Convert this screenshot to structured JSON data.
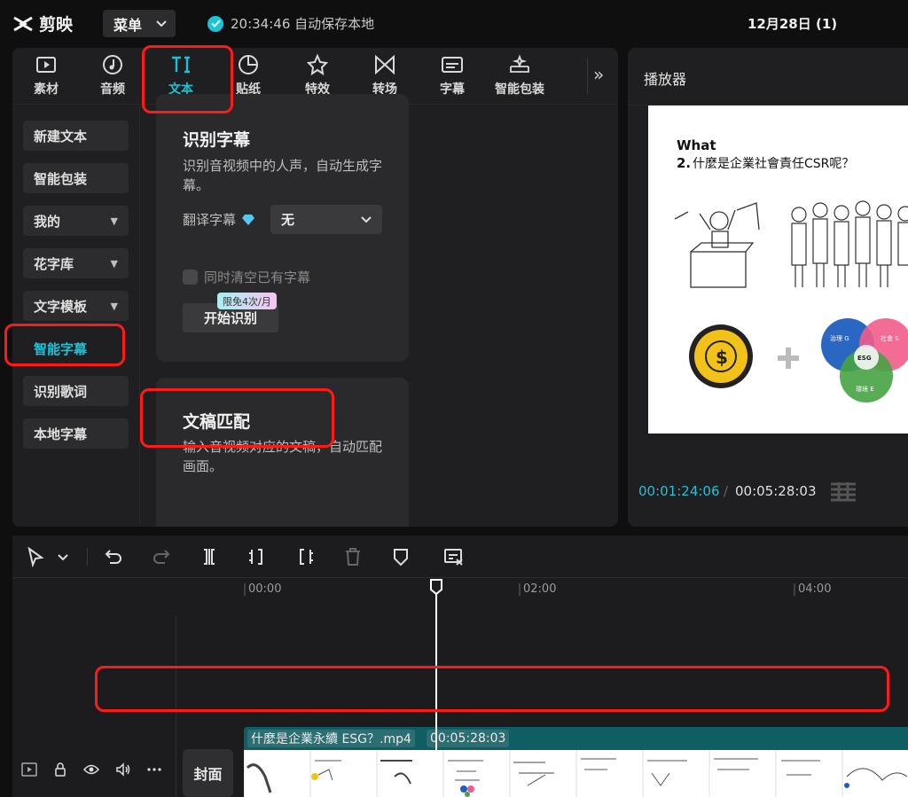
{
  "app": {
    "name": "剪映",
    "menu_label": "菜单",
    "autosave_text": "20:34:46 自动保存本地",
    "project_title": "12月28日 (1)"
  },
  "toolbar": {
    "tabs": [
      {
        "label": "素材",
        "icon": "media-icon"
      },
      {
        "label": "音频",
        "icon": "audio-icon"
      },
      {
        "label": "文本",
        "icon": "text-icon",
        "active": true
      },
      {
        "label": "贴纸",
        "icon": "sticker-icon"
      },
      {
        "label": "特效",
        "icon": "effects-icon"
      },
      {
        "label": "转场",
        "icon": "transition-icon"
      },
      {
        "label": "字幕",
        "icon": "subtitle-icon"
      },
      {
        "label": "智能包装",
        "icon": "smart-package-icon"
      }
    ],
    "more_label": "»"
  },
  "categories": [
    {
      "label": "新建文本",
      "has_dropdown": false
    },
    {
      "label": "智能包装",
      "has_dropdown": false
    },
    {
      "label": "我的",
      "has_dropdown": true
    },
    {
      "label": "花字库",
      "has_dropdown": true
    },
    {
      "label": "文字模板",
      "has_dropdown": true
    },
    {
      "label": "智能字幕",
      "has_dropdown": false,
      "active": true
    },
    {
      "label": "识别歌词",
      "has_dropdown": false
    },
    {
      "label": "本地字幕",
      "has_dropdown": false
    }
  ],
  "recognize_card": {
    "title": "识别字幕",
    "desc": "识别音视频中的人声，自动生成字幕。",
    "translate_label": "翻译字幕",
    "translate_value": "无",
    "clear_label": "同时清空已有字幕",
    "limit_badge": "限免4次/月",
    "start_label": "开始识别"
  },
  "match_card": {
    "title": "文稿匹配",
    "desc": "输入音视频对应的文稿，自动匹配画面。"
  },
  "player": {
    "title": "播放器",
    "current_time": "00:01:24:06",
    "total_time": "00:05:28:03",
    "frame_heading": "What",
    "frame_subheading_num": "2.",
    "frame_subheading": "什麼是企業社會責任CSR呢？",
    "venn_labels": [
      "治理 G",
      "社會 S",
      "環境 E"
    ],
    "venn_center": "ESG"
  },
  "timeline": {
    "ruler": [
      "00:00",
      "02:00",
      "04:00"
    ],
    "cover_label": "封面",
    "clip_name": "什麼是企業永續 ESG？.mp4",
    "clip_duration": "00:05:28:03"
  },
  "colors": {
    "accent": "#1bc3d6",
    "highlight": "#ff1a1a",
    "clip": "#0f5e63"
  }
}
